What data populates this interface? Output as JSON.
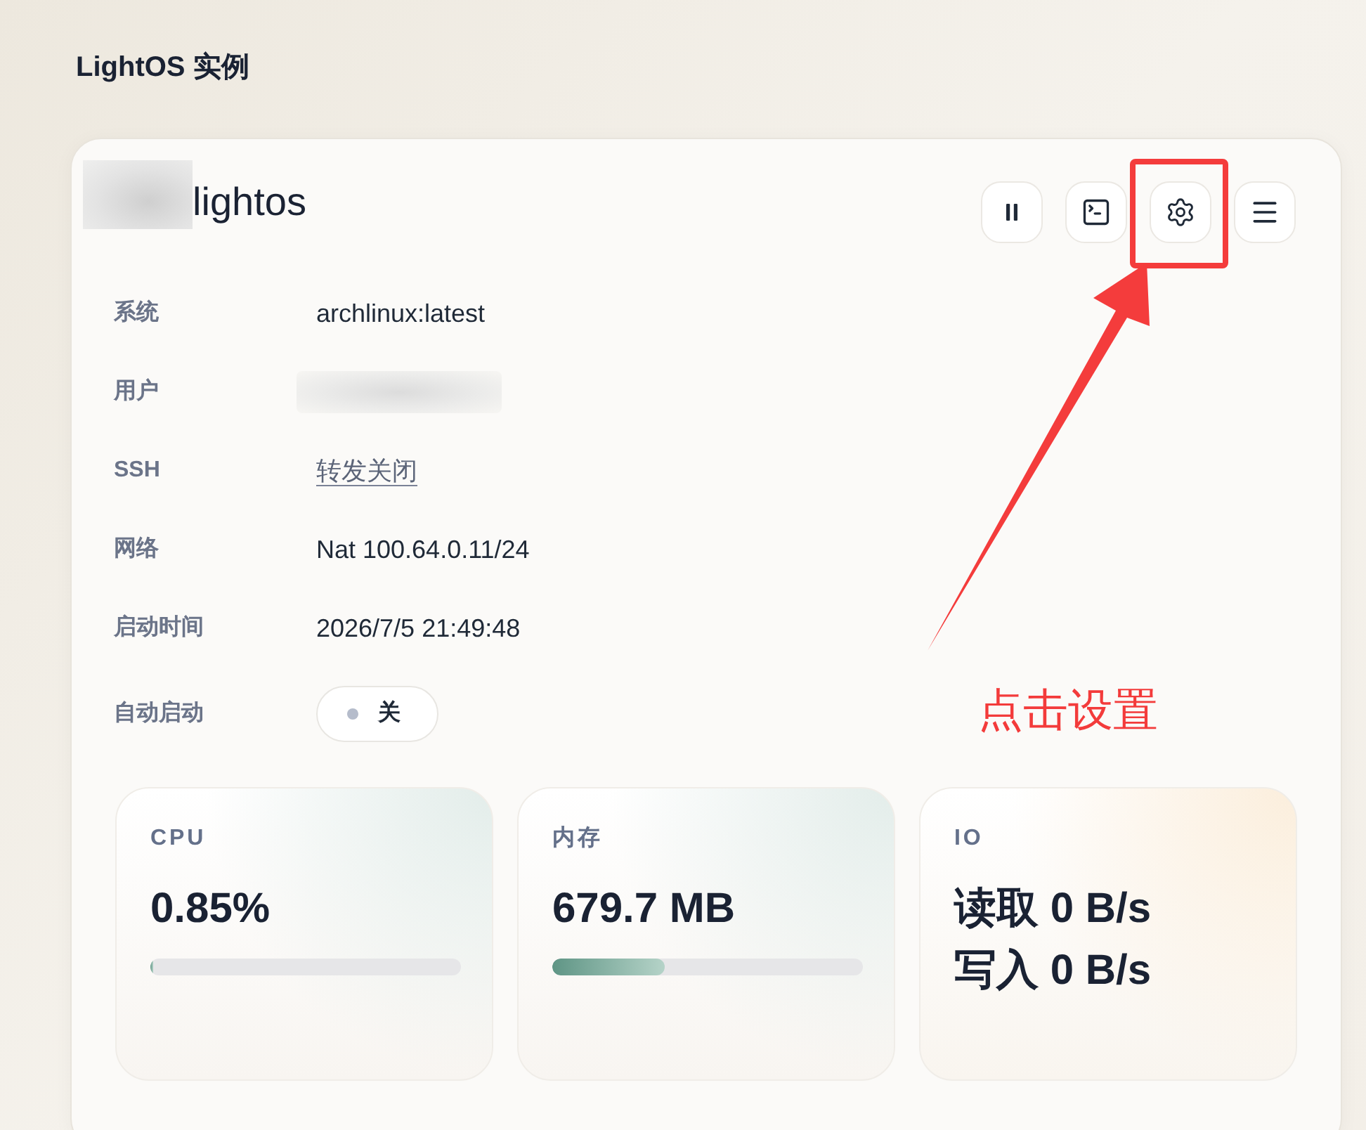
{
  "page": {
    "title": "LightOS 实例"
  },
  "instance": {
    "name": "lightos"
  },
  "details": [
    {
      "label": "系统",
      "kind": "text",
      "value": "archlinux:latest"
    },
    {
      "label": "用户",
      "kind": "redacted"
    },
    {
      "label": "SSH",
      "kind": "link",
      "value": "转发关闭"
    },
    {
      "label": "网络",
      "kind": "text",
      "value": "Nat 100.64.0.11/24"
    },
    {
      "label": "启动时间",
      "kind": "text",
      "value": "2026/7/5 21:49:48"
    },
    {
      "label": "自动启动",
      "kind": "toggle",
      "on": false,
      "value": "关"
    }
  ],
  "stats": [
    {
      "label": "CPU",
      "kind": "meter",
      "value": "0.85%",
      "level": 0.0085
    },
    {
      "label": "内存",
      "kind": "meter",
      "value": "679.7 MB",
      "level": 0.36
    },
    {
      "label": "IO",
      "kind": "lines",
      "lines": [
        "读取 0 B/s",
        "写入 0 B/s"
      ]
    }
  ],
  "annotation": {
    "text": "点击设置"
  }
}
